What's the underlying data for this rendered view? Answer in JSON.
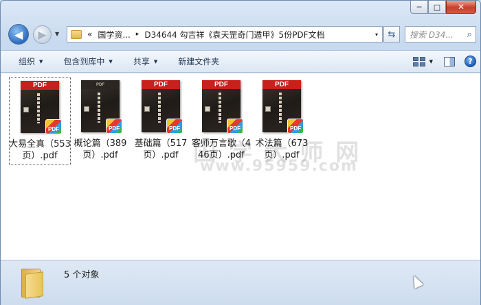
{
  "window": {
    "minimize": "─",
    "maximize": "□",
    "close": "✕"
  },
  "address": {
    "prefix": "«",
    "crumb_1": "国学资...",
    "separator": "▸",
    "crumb_2": "D34644 勾吉祥《袁天罡奇门遁甲》5份PDF文档",
    "dropdown": "▾"
  },
  "search": {
    "placeholder": "搜索 D34..."
  },
  "toolbar": {
    "organize": "组织",
    "include_in_library": "包含到库中",
    "share": "共享",
    "new_folder": "新建文件夹"
  },
  "files": [
    {
      "name": "大易全真（553页）.pdf"
    },
    {
      "name": "概论篇（389页）.pdf"
    },
    {
      "name": "基础篇（517页）.pdf"
    },
    {
      "name": "客师万言歌（446页）.pdf"
    },
    {
      "name": "术法篇（673页）.pdf"
    }
  ],
  "thumb_label": "PDF",
  "badge_label": "PDF",
  "watermark": {
    "text": "国 学 大 师 网",
    "url": "www.95959.com"
  },
  "status": {
    "count": "5 个对象"
  }
}
